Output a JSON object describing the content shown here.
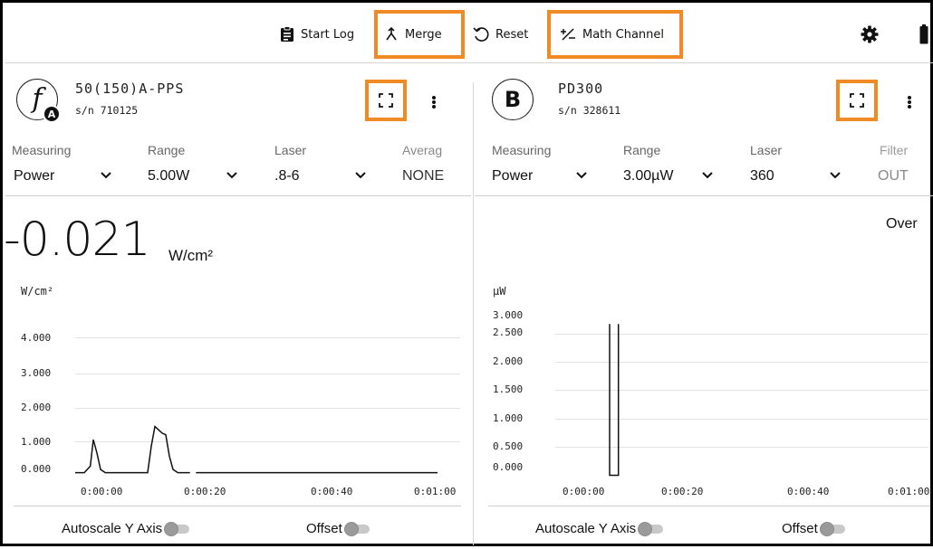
{
  "toolbar": {
    "start_log": "Start Log",
    "merge": "Merge",
    "reset": "Reset",
    "math_channel": "Math Channel",
    "icons": {
      "start_log": "clipboard-icon",
      "merge": "merge-icon",
      "reset": "reset-icon",
      "math_channel": "plus-minus-icon",
      "settings": "gear-icon",
      "battery": "battery-icon"
    }
  },
  "highlight_color": "#f08a24",
  "panel_a": {
    "badge_letter": "f",
    "badge_sub": "A",
    "device": "50(150)A-PPS",
    "serial": "s/n 710125",
    "measuring_label": "Measuring",
    "measuring_value": "Power",
    "range_label": "Range",
    "range_value": "5.00W",
    "laser_label": "Laser",
    "laser_value": ".8-6",
    "average_label": "Averag",
    "average_value": "NONE",
    "reading": "-0.021",
    "reading_unit": "W/cm²",
    "chart_unit": "W/cm²",
    "autoscale": "Autoscale Y Axis",
    "offset": "Offset"
  },
  "panel_b": {
    "badge_letter": "B",
    "device": "PD300",
    "serial": "s/n 328611",
    "measuring_label": "Measuring",
    "measuring_value": "Power",
    "range_label": "Range",
    "range_value": "3.00µW",
    "laser_label": "Laser",
    "laser_value": "360",
    "filter_label": "Filter",
    "filter_value": "OUT",
    "reading": "Over",
    "chart_unit": "µW",
    "autoscale": "Autoscale Y Axis",
    "offset": "Offset"
  },
  "chart_data": [
    {
      "type": "line",
      "ylabel": "W/cm²",
      "y_tick_labels": [
        "4.000",
        "3.000",
        "2.000",
        "1.000",
        "0.000"
      ],
      "x_tick_labels": [
        "0:00:00",
        "0:00:20",
        "0:00:40",
        "0:01:00"
      ],
      "ylim": [
        0,
        4
      ],
      "xlim": [
        0,
        60
      ],
      "grid": true,
      "series": [
        {
          "x": [
            0,
            1.5,
            2.5,
            3.0,
            3.6,
            4.2,
            5.0,
            6.0,
            9.0,
            12.0,
            12.6,
            13.2,
            13.8,
            14.4,
            15.0,
            15.6,
            16.2,
            17.0,
            19.0
          ],
          "y": [
            -0.1,
            -0.1,
            0.1,
            0.9,
            0.5,
            0.0,
            -0.1,
            -0.1,
            -0.1,
            -0.1,
            0.7,
            1.3,
            1.2,
            1.1,
            1.05,
            0.4,
            0.0,
            -0.1,
            -0.1
          ]
        },
        {
          "x": [
            20,
            60
          ],
          "y": [
            -0.1,
            -0.1
          ]
        }
      ]
    },
    {
      "type": "line",
      "ylabel": "µW",
      "y_tick_labels": [
        "3.000",
        "2.500",
        "2.000",
        "1.500",
        "1.000",
        "0.500",
        "0.000"
      ],
      "x_tick_labels": [
        "0:00:00",
        "0:00:20",
        "0:00:40",
        "0:01:00"
      ],
      "ylim": [
        0,
        3
      ],
      "xlim": [
        0,
        60
      ],
      "grid": true,
      "series": [
        {
          "x": [
            8.5,
            8.5,
            8.5,
            10.0,
            10.0,
            10.0
          ],
          "y": [
            -0.15,
            2.8,
            -0.15,
            -0.15,
            2.8,
            -0.15
          ]
        }
      ]
    }
  ]
}
